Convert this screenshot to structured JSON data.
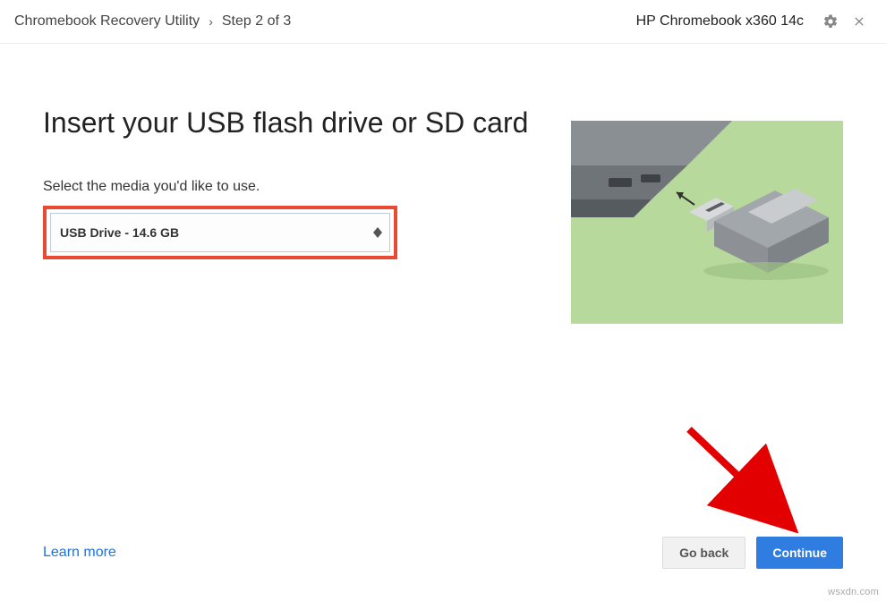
{
  "header": {
    "app_title": "Chromebook Recovery Utility",
    "step_label": "Step 2 of 3",
    "device_name": "HP Chromebook x360 14c"
  },
  "main": {
    "heading": "Insert your USB flash drive or SD card",
    "instruction": "Select the media you'd like to use.",
    "selected_media": "USB Drive - 14.6 GB"
  },
  "footer": {
    "learn_more_label": "Learn more",
    "go_back_label": "Go back",
    "continue_label": "Continue"
  },
  "watermark": "wsxdn.com"
}
